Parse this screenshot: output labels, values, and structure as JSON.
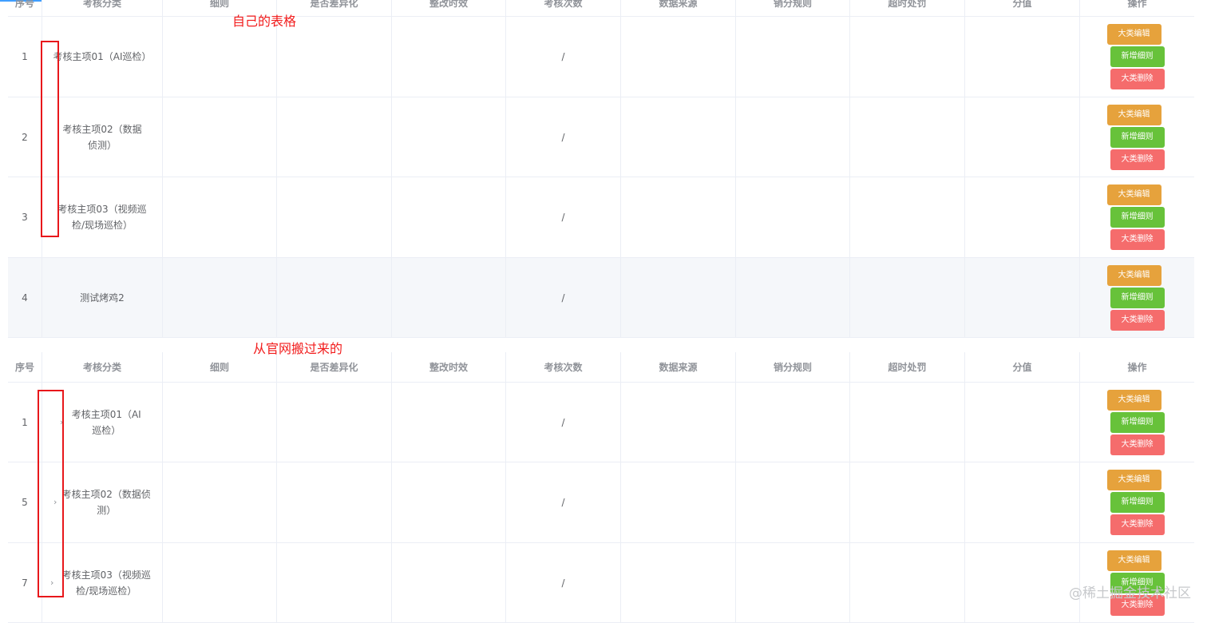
{
  "columns": [
    "序号",
    "考核分类",
    "细则",
    "是否差异化",
    "整改时效",
    "考核次数",
    "数据来源",
    "销分规则",
    "超时处罚",
    "分值",
    "操作"
  ],
  "buttons": {
    "edit": "大类编辑",
    "add": "新增细则",
    "delete": "大类删除"
  },
  "table1": {
    "rows": [
      {
        "index": "1",
        "category": "考核主项01（AI巡检）",
        "count": "/"
      },
      {
        "index": "2",
        "category": "考核主项02（数据侦测）",
        "count": "/"
      },
      {
        "index": "3",
        "category": "考核主项03（视频巡检/现场巡检）",
        "count": "/"
      },
      {
        "index": "4",
        "category": "测试烤鸡2",
        "count": "/"
      }
    ]
  },
  "table2": {
    "rows": [
      {
        "index": "1",
        "expand": "›",
        "category": "考核主项01（AI巡检）",
        "count": "/"
      },
      {
        "index": "5",
        "expand": "›",
        "category": "考核主项02（数据侦测）",
        "count": "/"
      },
      {
        "index": "7",
        "expand": "›",
        "category": "考核主项03（视频巡检/现场巡检）",
        "count": "/"
      }
    ]
  },
  "annotations": {
    "own_table": "自己的表格",
    "from_official": "从官网搬过来的"
  },
  "colors": {
    "annotation": "#f21b1b",
    "edit": "#e6a23c",
    "add": "#67c23a",
    "delete": "#f56c6c"
  },
  "watermark": "@稀土掘金技术社区"
}
